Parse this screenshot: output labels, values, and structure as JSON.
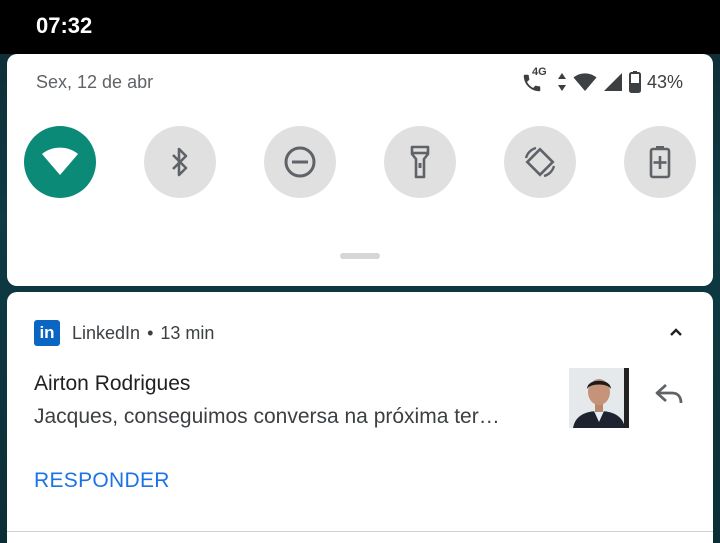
{
  "statusbar": {
    "time": "07:32"
  },
  "quick_settings": {
    "date": "Sex, 12 de abr",
    "network_type": "4G",
    "battery_percent": "43%",
    "tiles": [
      {
        "name": "wifi",
        "active": true
      },
      {
        "name": "bluetooth",
        "active": false
      },
      {
        "name": "do-not-disturb",
        "active": false
      },
      {
        "name": "flashlight",
        "active": false
      },
      {
        "name": "auto-rotate",
        "active": false
      },
      {
        "name": "battery-saver",
        "active": false
      }
    ],
    "colors": {
      "active_tile": "#0b8a78",
      "inactive_tile": "#e0e0e0"
    }
  },
  "notification": {
    "app_name": "LinkedIn",
    "separator": "•",
    "time_ago": "13 min",
    "sender": "Airton Rodrigues",
    "message": "Jacques, conseguimos conversa na próxima ter…",
    "action_label": "RESPONDER",
    "app_logo_text": "in",
    "colors": {
      "linkedin_blue": "#0a66c2",
      "action": "#1a73e8"
    }
  }
}
